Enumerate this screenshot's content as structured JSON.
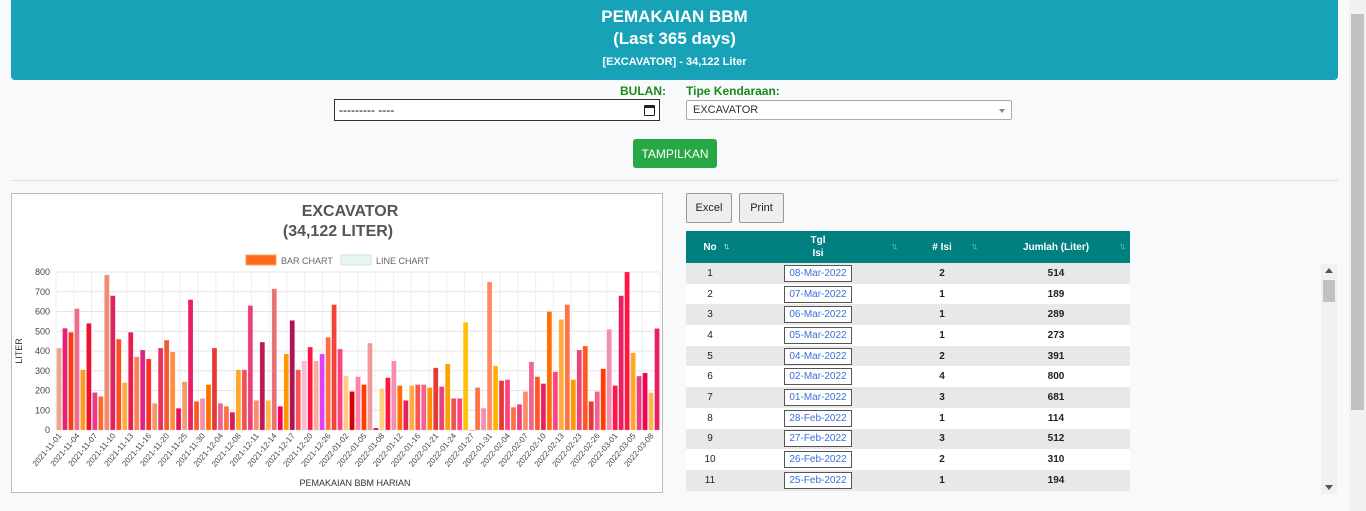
{
  "header": {
    "title": "PEMAKAIAN BBM",
    "subtitle": "(Last 365 days)",
    "summary": "[EXCAVATOR] - 34,122 Liter"
  },
  "filters": {
    "bulan_label": "BULAN:",
    "bulan_value": "--------- ----",
    "tipe_label": "Tipe Kendaraan:",
    "tipe_value": "EXCAVATOR",
    "submit_label": "TAMPILKAN"
  },
  "actions": {
    "excel_label": "Excel",
    "print_label": "Print"
  },
  "table": {
    "headers": [
      "No",
      "Tgl Isi",
      "# Isi",
      "Jumlah (Liter)"
    ],
    "rows": [
      {
        "no": "1",
        "tgl": "08-Mar-2022",
        "isi": "2",
        "jumlah": "514"
      },
      {
        "no": "2",
        "tgl": "07-Mar-2022",
        "isi": "1",
        "jumlah": "189"
      },
      {
        "no": "3",
        "tgl": "06-Mar-2022",
        "isi": "1",
        "jumlah": "289"
      },
      {
        "no": "4",
        "tgl": "05-Mar-2022",
        "isi": "1",
        "jumlah": "273"
      },
      {
        "no": "5",
        "tgl": "04-Mar-2022",
        "isi": "2",
        "jumlah": "391"
      },
      {
        "no": "6",
        "tgl": "02-Mar-2022",
        "isi": "4",
        "jumlah": "800"
      },
      {
        "no": "7",
        "tgl": "01-Mar-2022",
        "isi": "3",
        "jumlah": "681"
      },
      {
        "no": "8",
        "tgl": "28-Feb-2022",
        "isi": "1",
        "jumlah": "114"
      },
      {
        "no": "9",
        "tgl": "27-Feb-2022",
        "isi": "3",
        "jumlah": "512"
      },
      {
        "no": "10",
        "tgl": "26-Feb-2022",
        "isi": "2",
        "jumlah": "310"
      },
      {
        "no": "11",
        "tgl": "25-Feb-2022",
        "isi": "1",
        "jumlah": "194"
      }
    ]
  },
  "chart_data": {
    "type": "bar",
    "title": "EXCAVATOR",
    "subtitle": "(34,122 LITER)",
    "xlabel": "PEMAKAIAN BBM HARIAN",
    "ylabel": "LITER",
    "ylim": [
      0,
      800
    ],
    "yticks": [
      0,
      100,
      200,
      300,
      400,
      500,
      600,
      700,
      800
    ],
    "grid": true,
    "legend": [
      "BAR CHART",
      "LINE CHART"
    ],
    "legend_position": "top",
    "legend_colors": [
      "#ff6a1a",
      "#e6f5ee"
    ],
    "tick_labels": [
      "2021-11-01",
      "2021-11-04",
      "2021-11-07",
      "2021-11-10",
      "2021-11-13",
      "2021-11-16",
      "2021-11-20",
      "2021-11-25",
      "2021-11-30",
      "2021-12-04",
      "2021-12-08",
      "2021-12-11",
      "2021-12-14",
      "2021-12-17",
      "2021-12-20",
      "2021-12-26",
      "2022-01-02",
      "2022-01-05",
      "2022-01-08",
      "2022-01-12",
      "2022-01-16",
      "2022-01-21",
      "2022-01-24",
      "2022-01-27",
      "2022-01-31",
      "2022-02-04",
      "2022-02-07",
      "2022-02-10",
      "2022-02-13",
      "2022-02-23",
      "2022-02-26",
      "2022-03-01",
      "2022-03-05",
      "2022-03-08"
    ],
    "values": [
      415,
      515,
      495,
      615,
      305,
      540,
      190,
      170,
      785,
      680,
      460,
      240,
      495,
      370,
      405,
      360,
      135,
      415,
      455,
      395,
      110,
      245,
      660,
      145,
      160,
      230,
      415,
      135,
      120,
      90,
      305,
      305,
      630,
      150,
      445,
      150,
      715,
      120,
      385,
      555,
      305,
      350,
      420,
      350,
      385,
      470,
      635,
      410,
      275,
      195,
      270,
      230,
      440,
      10,
      210,
      265,
      350,
      225,
      150,
      225,
      230,
      230,
      215,
      315,
      220,
      335,
      160,
      160,
      545,
      0,
      215,
      110,
      750,
      325,
      250,
      255,
      115,
      130,
      195,
      345,
      270,
      235,
      600,
      295,
      560,
      635,
      255,
      405,
      425,
      145,
      195,
      310,
      510,
      225,
      680,
      800,
      391,
      273,
      289,
      189,
      514
    ],
    "colors": [
      "#f2a48a",
      "#e8207a",
      "#ff3b10",
      "#f06a8a",
      "#ff9a20",
      "#ee1030",
      "#e83a8a",
      "#ff6a2a",
      "#f08a70",
      "#e02060",
      "#ff4f20",
      "#f7b040",
      "#e61e4d",
      "#ff7f50",
      "#dd2288",
      "#ff3020",
      "#f29a6a",
      "#e83060",
      "#f05a30",
      "#ff8c40",
      "#e6105a",
      "#f39c6b",
      "#e91e63",
      "#ff5722",
      "#f48fb1",
      "#ff6f00",
      "#e53935",
      "#f06292",
      "#ff7043",
      "#d81b60",
      "#ffa726",
      "#ef5350",
      "#ec407a",
      "#ff8a65",
      "#c2185b",
      "#ffb74d",
      "#e57373",
      "#f50057",
      "#ff9800",
      "#ad1457",
      "#ff5252",
      "#f8bbd0",
      "#ff1744",
      "#ffab91",
      "#e040fb",
      "#ff6e40",
      "#f44336",
      "#ff4081",
      "#ffcc80",
      "#d50000",
      "#ff80ab",
      "#ff3d00",
      "#ef9a9a",
      "#c51162",
      "#ffd180",
      "#ff1744",
      "#f48fb1",
      "#ff6d00",
      "#e91e63",
      "#ffab40",
      "#ff5252",
      "#f06292",
      "#ff9100",
      "#e53935",
      "#ec407a",
      "#ffa000",
      "#ef5350",
      "#ff4081",
      "#ffc107",
      "#e91e63",
      "#ff7043",
      "#f48fb1",
      "#ff8a65",
      "#ffb300",
      "#e53935",
      "#ff4081",
      "#ff7043",
      "#ec407a",
      "#ff8a65",
      "#f06292",
      "#ff5722",
      "#e91e63",
      "#ff6f00",
      "#ff4081",
      "#ffab40",
      "#ff7043",
      "#ff9800",
      "#ec407a",
      "#ff5722",
      "#e53935",
      "#f06292",
      "#ff3d00",
      "#f48fb1",
      "#ff1744",
      "#e91e63",
      "#ff1744",
      "#ffa726",
      "#ec407a",
      "#f50057",
      "#ffb74d",
      "#e91e63"
    ]
  }
}
